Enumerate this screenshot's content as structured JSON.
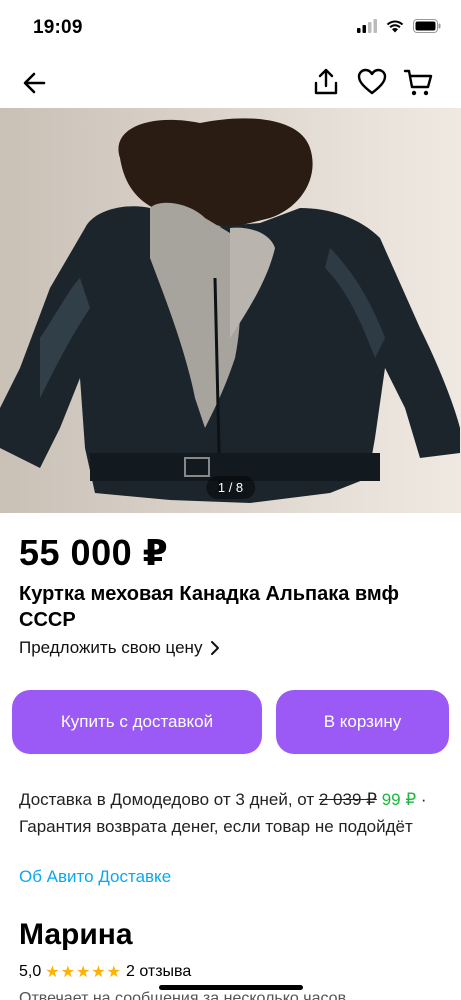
{
  "status": {
    "time": "19:09"
  },
  "gallery": {
    "counter": "1 / 8"
  },
  "product": {
    "price": "55 000 ₽",
    "title": "Куртка меховая Канадка Альпака вмф СССР",
    "offer_price_label": "Предложить свою цену"
  },
  "actions": {
    "buy_label": "Купить с доставкой",
    "cart_label": "В корзину",
    "accent_color": "#9b5af5"
  },
  "delivery": {
    "text": "Доставка в Домодедово от 3 дней, от ",
    "old_price": "2 039 ₽",
    "new_price": "99 ₽",
    "guarantee": " · Гарантия возврата денег, если товар не подойдёт",
    "link": "Об Авито Доставке"
  },
  "seller": {
    "name": "Марина",
    "rating": "5,0",
    "stars": "★★★★★",
    "reviews": "2 отзыва",
    "response_note": "Отвечает на сообщения за несколько часов"
  }
}
